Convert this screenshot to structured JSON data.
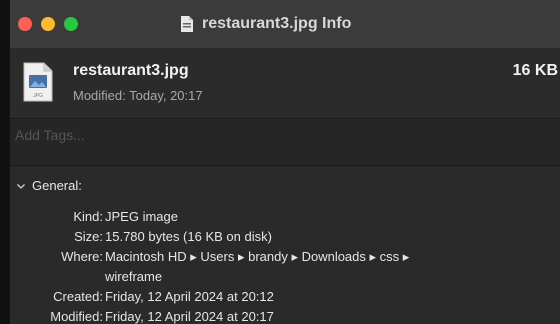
{
  "window": {
    "title": "restaurant3.jpg Info"
  },
  "file": {
    "name": "restaurant3.jpg",
    "modified": "Modified: Today, 20:17",
    "size": "16 KB",
    "icon": "jpeg-document-icon"
  },
  "tags": {
    "placeholder": "Add Tags..."
  },
  "general": {
    "header": "General:",
    "rows": [
      {
        "label": "Kind:",
        "value": "JPEG image"
      },
      {
        "label": "Size:",
        "value": "15.780 bytes (16 KB on disk)"
      },
      {
        "label": "Where:",
        "value": "Macintosh HD ▸ Users ▸ brandy ▸ Downloads ▸ css ▸",
        "value2": "wireframe"
      },
      {
        "label": "Created:",
        "value": "Friday, 12 April 2024 at 20:12"
      },
      {
        "label": "Modified:",
        "value": "Friday, 12 April 2024 at 20:17"
      }
    ]
  },
  "colors": {
    "close": "#ff5f57",
    "minimize": "#febc2e",
    "zoom": "#28c840"
  }
}
